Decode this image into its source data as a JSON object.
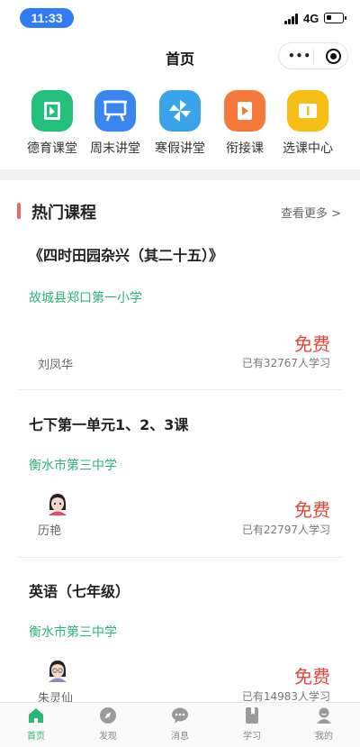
{
  "status_bar": {
    "time": "11:33",
    "network": "4G"
  },
  "navbar": {
    "title": "首页"
  },
  "categories": [
    {
      "label": "德育课堂",
      "icon": "book-icon",
      "color": "#22c07a"
    },
    {
      "label": "周末讲堂",
      "icon": "easel-icon",
      "color": "#3a86f0"
    },
    {
      "label": "寒假讲堂",
      "icon": "pinwheel-icon",
      "color": "#3aa4ea"
    },
    {
      "label": "衔接课",
      "icon": "video-icon",
      "color": "#f5793b"
    },
    {
      "label": "选课中心",
      "icon": "notice-icon",
      "color": "#f7be16"
    }
  ],
  "section": {
    "title": "热门课程",
    "more": "查看更多 >"
  },
  "courses": [
    {
      "title": "《四时田园杂兴（其二十五）》",
      "school": "故城县郑口第一小学",
      "teacher": "刘凤华",
      "price": "免费",
      "learners": "已有32767人学习"
    },
    {
      "title": "七下第一单元1、2、3课",
      "school": "衡水市第三中学",
      "teacher": "历艳",
      "price": "免费",
      "learners": "已有22797人学习"
    },
    {
      "title": "英语（七年级）",
      "school": "衡水市第三中学",
      "teacher": "朱灵仙",
      "price": "免费",
      "learners": "已有14983人学习"
    }
  ],
  "tabs": [
    {
      "label": "首页",
      "icon": "home-icon",
      "active": true
    },
    {
      "label": "发现",
      "icon": "compass-icon",
      "active": false
    },
    {
      "label": "消息",
      "icon": "chat-icon",
      "active": false
    },
    {
      "label": "学习",
      "icon": "bookmark-book-icon",
      "active": false
    },
    {
      "label": "我的",
      "icon": "user-icon",
      "active": false
    }
  ],
  "colors": {
    "accent_green": "#2bb673",
    "price_red": "#e0473a",
    "section_bar": "#e86a6a"
  }
}
